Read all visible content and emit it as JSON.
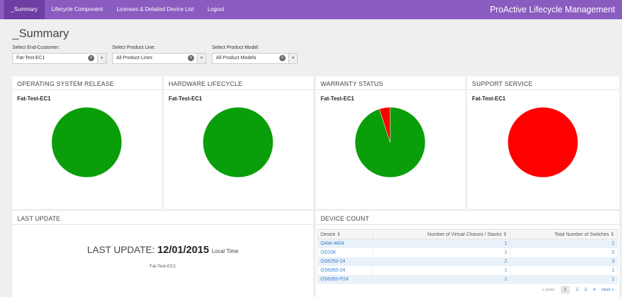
{
  "nav": {
    "items": [
      "_Summary",
      "Lifecycle Component",
      "Licenses & Detailed Device List",
      "Logout"
    ],
    "brand": "ProActive Lifecycle Management"
  },
  "page_title": "_Summary",
  "filters": [
    {
      "label": "Select End-Customer:",
      "value": "Fat-Test-EC1"
    },
    {
      "label": "Select Product Line:",
      "value": "All Product Lines"
    },
    {
      "label": "Select Product Model:",
      "value": "All Product Models"
    }
  ],
  "panels": {
    "os": {
      "title": "OPERATING SYSTEM RELEASE",
      "subtitle": "Fat-Test-EC1"
    },
    "hw": {
      "title": "HARDWARE LIFECYCLE",
      "subtitle": "Fat-Test-EC1"
    },
    "warranty": {
      "title": "WARRANTY STATUS",
      "subtitle": "Fat-Test-EC1"
    },
    "support": {
      "title": "SUPPORT SERVICE",
      "subtitle": "Fat-Test-EC1"
    },
    "last_update": {
      "title": "LAST UPDATE",
      "prefix": "LAST UPDATE:",
      "date": "12/01/2015",
      "suffix": "Local Time",
      "customer": "Fat-Test-EC1"
    },
    "device_count": {
      "title": "DEVICE COUNT",
      "columns": [
        "Device ⇕",
        "Number of Virtual Chassis / Stacks ⇕",
        "Total Number of Switches ⇕"
      ],
      "rows": [
        [
          "OAW-4604",
          "1",
          "1"
        ],
        [
          "OS10K",
          "1",
          "2"
        ],
        [
          "OS6250-24",
          "2",
          "3"
        ],
        [
          "OS6350-24",
          "1",
          "1"
        ],
        [
          "OS6350-P24",
          "1",
          "1"
        ]
      ],
      "pager": {
        "prev": "« prev",
        "pages": [
          "1",
          "2",
          "3",
          "4"
        ],
        "next": "next »"
      }
    }
  },
  "chart_data": [
    {
      "type": "pie",
      "chart": "os",
      "slices": [
        {
          "value": 100,
          "color": "#0a9e0a"
        }
      ]
    },
    {
      "type": "pie",
      "chart": "hw",
      "slices": [
        {
          "value": 100,
          "color": "#0a9e0a"
        }
      ]
    },
    {
      "type": "pie",
      "chart": "warranty",
      "slices": [
        {
          "value": 95,
          "color": "#0a9e0a"
        },
        {
          "value": 5,
          "color": "#ff0000"
        }
      ]
    },
    {
      "type": "pie",
      "chart": "support",
      "slices": [
        {
          "value": 100,
          "color": "#ff0000"
        }
      ]
    }
  ],
  "colors": {
    "nav": "#8a5cc0",
    "green": "#0a9e0a",
    "red": "#ff0000",
    "link": "#2a7fd0"
  }
}
